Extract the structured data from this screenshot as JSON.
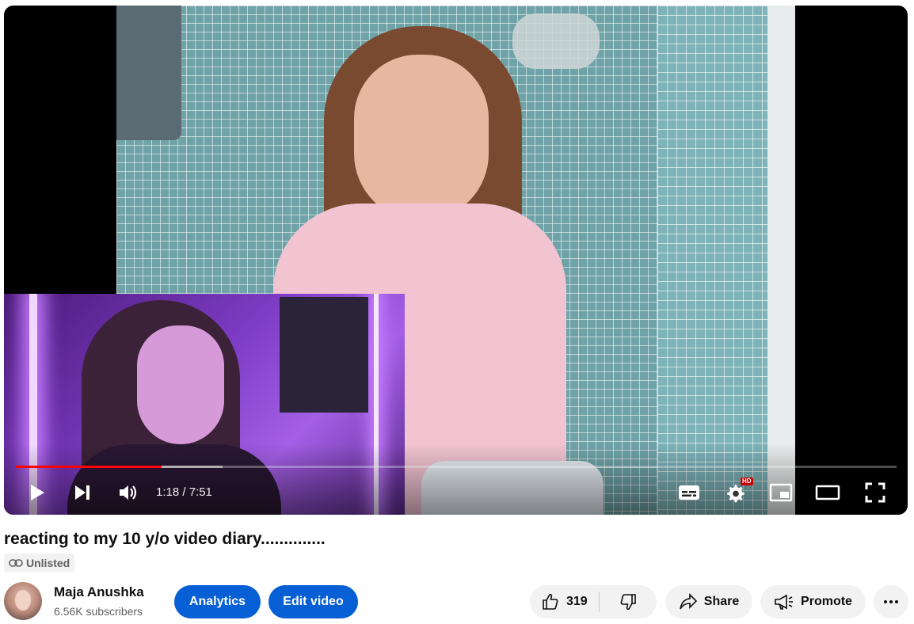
{
  "player": {
    "progress_played_fraction": 0.166,
    "progress_buffered_fraction": 0.235,
    "current_time": "1:18",
    "duration": "7:51",
    "time_display": "1:18 / 7:51",
    "hd_badge": "HD",
    "accent_color": "#ff0000"
  },
  "video": {
    "title": "reacting to my 10 y/o video diary..............",
    "visibility": "Unlisted"
  },
  "channel": {
    "name": "Maja Anushka",
    "subscribers": "6.56K subscribers"
  },
  "actions": {
    "analytics_label": "Analytics",
    "edit_label": "Edit video",
    "like_count": "319",
    "share_label": "Share",
    "promote_label": "Promote",
    "primary_color": "#065fd4"
  },
  "icons": {
    "play": "play-icon",
    "next": "next-icon",
    "volume": "volume-icon",
    "subtitles": "subtitles-icon",
    "settings": "gear-icon",
    "miniplayer": "miniplayer-icon",
    "theater": "theater-icon",
    "fullscreen": "fullscreen-icon",
    "link": "link-icon",
    "like": "thumbs-up-icon",
    "dislike": "thumbs-down-icon",
    "share": "share-arrow-icon",
    "promote": "megaphone-icon",
    "more": "more-dots-icon"
  }
}
